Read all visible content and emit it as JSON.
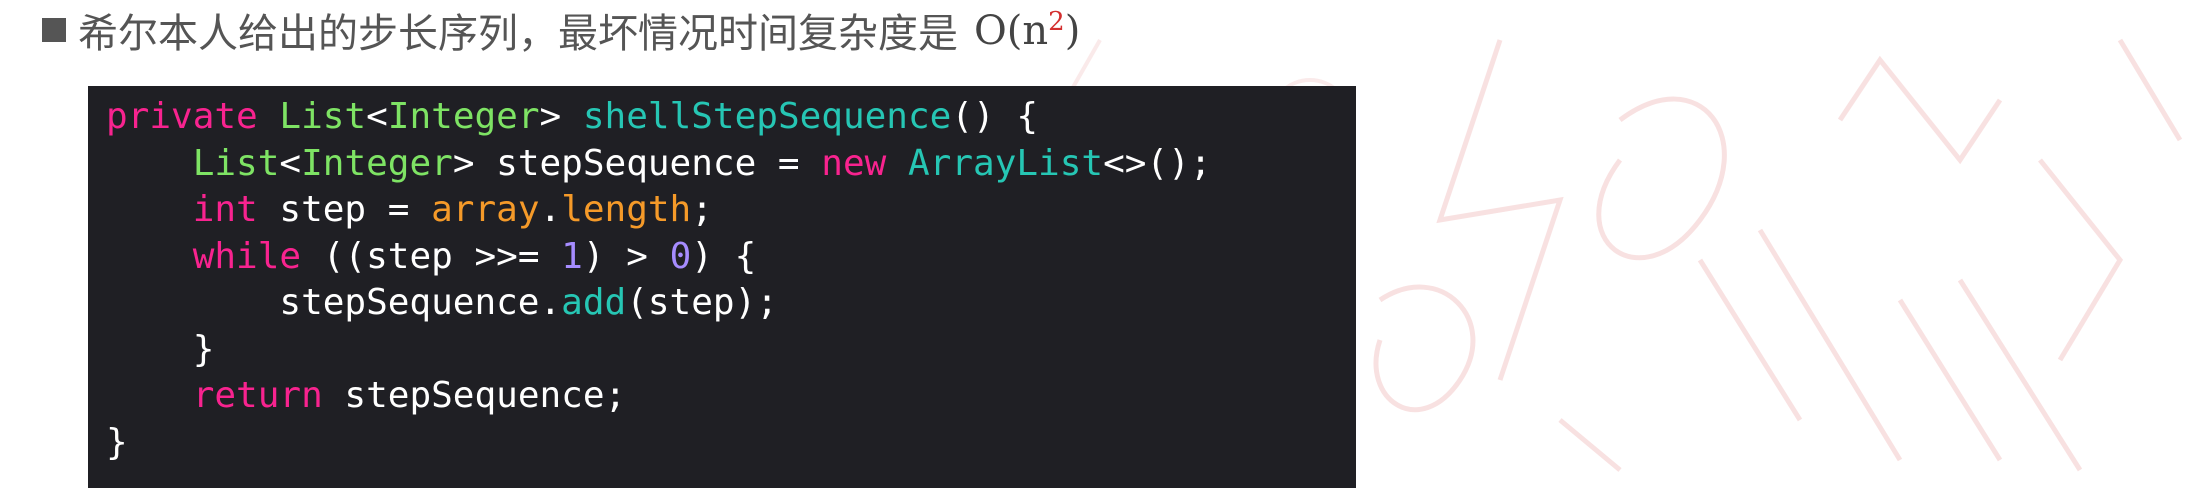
{
  "heading": {
    "text": "希尔本人给出的步长序列，最坏情况时间复杂度是",
    "complexity_base": "O(n",
    "complexity_exp": "2",
    "complexity_close": ")"
  },
  "code": {
    "lines": [
      [
        {
          "t": "private",
          "c": "kw"
        },
        {
          "t": " ",
          "c": "pl"
        },
        {
          "t": "List",
          "c": "ty"
        },
        {
          "t": "<",
          "c": "pl"
        },
        {
          "t": "Integer",
          "c": "ty"
        },
        {
          "t": "> ",
          "c": "pl"
        },
        {
          "t": "shellStepSequence",
          "c": "fn"
        },
        {
          "t": "() {",
          "c": "pl"
        }
      ],
      [
        {
          "t": "    ",
          "c": "pl"
        },
        {
          "t": "List",
          "c": "ty"
        },
        {
          "t": "<",
          "c": "pl"
        },
        {
          "t": "Integer",
          "c": "ty"
        },
        {
          "t": "> stepSequence = ",
          "c": "pl"
        },
        {
          "t": "new",
          "c": "kw"
        },
        {
          "t": " ",
          "c": "pl"
        },
        {
          "t": "ArrayList",
          "c": "fn"
        },
        {
          "t": "<>();",
          "c": "pl"
        }
      ],
      [
        {
          "t": "    ",
          "c": "pl"
        },
        {
          "t": "int",
          "c": "kw"
        },
        {
          "t": " step = ",
          "c": "pl"
        },
        {
          "t": "array",
          "c": "obj"
        },
        {
          "t": ".",
          "c": "pl"
        },
        {
          "t": "length",
          "c": "obj"
        },
        {
          "t": ";",
          "c": "pl"
        }
      ],
      [
        {
          "t": "    ",
          "c": "pl"
        },
        {
          "t": "while",
          "c": "kw"
        },
        {
          "t": " ((step >>= ",
          "c": "pl"
        },
        {
          "t": "1",
          "c": "num"
        },
        {
          "t": ") > ",
          "c": "pl"
        },
        {
          "t": "0",
          "c": "num"
        },
        {
          "t": ") {",
          "c": "pl"
        }
      ],
      [
        {
          "t": "        stepSequence.",
          "c": "pl"
        },
        {
          "t": "add",
          "c": "fn"
        },
        {
          "t": "(step);",
          "c": "pl"
        }
      ],
      [
        {
          "t": "    }",
          "c": "pl"
        }
      ],
      [
        {
          "t": "    ",
          "c": "pl"
        },
        {
          "t": "return",
          "c": "kw"
        },
        {
          "t": " stepSequence;",
          "c": "pl"
        }
      ],
      [
        {
          "t": "}",
          "c": "pl"
        }
      ]
    ]
  },
  "colors": {
    "code_background": "#1f1f24",
    "keyword": "#f8238f",
    "type": "#7ee364",
    "function": "#26c6b4",
    "number": "#a68cff",
    "field": "#f59a29",
    "text": "#555555",
    "exponent": "#d32f2f"
  }
}
